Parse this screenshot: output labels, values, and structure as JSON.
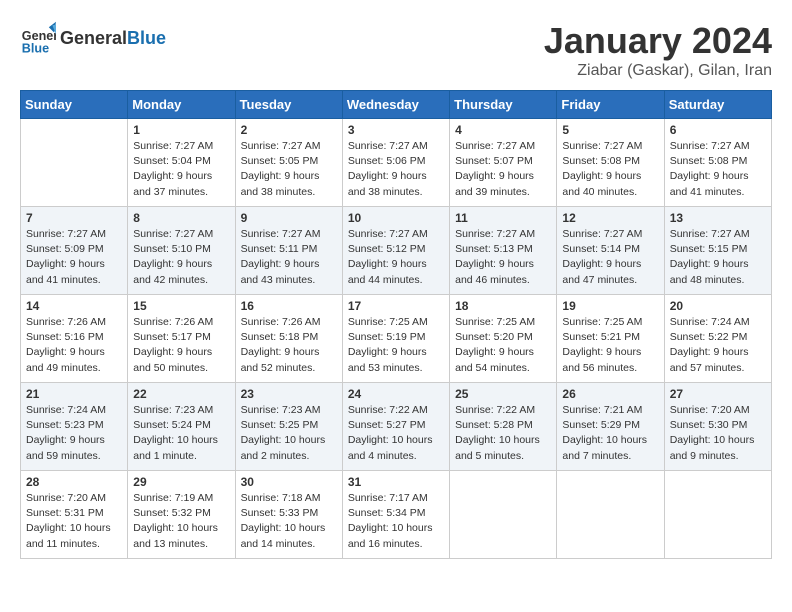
{
  "header": {
    "logo_general": "General",
    "logo_blue": "Blue",
    "month_title": "January 2024",
    "location": "Ziabar (Gaskar), Gilan, Iran"
  },
  "days_of_week": [
    "Sunday",
    "Monday",
    "Tuesday",
    "Wednesday",
    "Thursday",
    "Friday",
    "Saturday"
  ],
  "weeks": [
    [
      {
        "day": "",
        "info": ""
      },
      {
        "day": "1",
        "info": "Sunrise: 7:27 AM\nSunset: 5:04 PM\nDaylight: 9 hours\nand 37 minutes."
      },
      {
        "day": "2",
        "info": "Sunrise: 7:27 AM\nSunset: 5:05 PM\nDaylight: 9 hours\nand 38 minutes."
      },
      {
        "day": "3",
        "info": "Sunrise: 7:27 AM\nSunset: 5:06 PM\nDaylight: 9 hours\nand 38 minutes."
      },
      {
        "day": "4",
        "info": "Sunrise: 7:27 AM\nSunset: 5:07 PM\nDaylight: 9 hours\nand 39 minutes."
      },
      {
        "day": "5",
        "info": "Sunrise: 7:27 AM\nSunset: 5:08 PM\nDaylight: 9 hours\nand 40 minutes."
      },
      {
        "day": "6",
        "info": "Sunrise: 7:27 AM\nSunset: 5:08 PM\nDaylight: 9 hours\nand 41 minutes."
      }
    ],
    [
      {
        "day": "7",
        "info": "Sunrise: 7:27 AM\nSunset: 5:09 PM\nDaylight: 9 hours\nand 41 minutes."
      },
      {
        "day": "8",
        "info": "Sunrise: 7:27 AM\nSunset: 5:10 PM\nDaylight: 9 hours\nand 42 minutes."
      },
      {
        "day": "9",
        "info": "Sunrise: 7:27 AM\nSunset: 5:11 PM\nDaylight: 9 hours\nand 43 minutes."
      },
      {
        "day": "10",
        "info": "Sunrise: 7:27 AM\nSunset: 5:12 PM\nDaylight: 9 hours\nand 44 minutes."
      },
      {
        "day": "11",
        "info": "Sunrise: 7:27 AM\nSunset: 5:13 PM\nDaylight: 9 hours\nand 46 minutes."
      },
      {
        "day": "12",
        "info": "Sunrise: 7:27 AM\nSunset: 5:14 PM\nDaylight: 9 hours\nand 47 minutes."
      },
      {
        "day": "13",
        "info": "Sunrise: 7:27 AM\nSunset: 5:15 PM\nDaylight: 9 hours\nand 48 minutes."
      }
    ],
    [
      {
        "day": "14",
        "info": "Sunrise: 7:26 AM\nSunset: 5:16 PM\nDaylight: 9 hours\nand 49 minutes."
      },
      {
        "day": "15",
        "info": "Sunrise: 7:26 AM\nSunset: 5:17 PM\nDaylight: 9 hours\nand 50 minutes."
      },
      {
        "day": "16",
        "info": "Sunrise: 7:26 AM\nSunset: 5:18 PM\nDaylight: 9 hours\nand 52 minutes."
      },
      {
        "day": "17",
        "info": "Sunrise: 7:25 AM\nSunset: 5:19 PM\nDaylight: 9 hours\nand 53 minutes."
      },
      {
        "day": "18",
        "info": "Sunrise: 7:25 AM\nSunset: 5:20 PM\nDaylight: 9 hours\nand 54 minutes."
      },
      {
        "day": "19",
        "info": "Sunrise: 7:25 AM\nSunset: 5:21 PM\nDaylight: 9 hours\nand 56 minutes."
      },
      {
        "day": "20",
        "info": "Sunrise: 7:24 AM\nSunset: 5:22 PM\nDaylight: 9 hours\nand 57 minutes."
      }
    ],
    [
      {
        "day": "21",
        "info": "Sunrise: 7:24 AM\nSunset: 5:23 PM\nDaylight: 9 hours\nand 59 minutes."
      },
      {
        "day": "22",
        "info": "Sunrise: 7:23 AM\nSunset: 5:24 PM\nDaylight: 10 hours\nand 1 minute."
      },
      {
        "day": "23",
        "info": "Sunrise: 7:23 AM\nSunset: 5:25 PM\nDaylight: 10 hours\nand 2 minutes."
      },
      {
        "day": "24",
        "info": "Sunrise: 7:22 AM\nSunset: 5:27 PM\nDaylight: 10 hours\nand 4 minutes."
      },
      {
        "day": "25",
        "info": "Sunrise: 7:22 AM\nSunset: 5:28 PM\nDaylight: 10 hours\nand 5 minutes."
      },
      {
        "day": "26",
        "info": "Sunrise: 7:21 AM\nSunset: 5:29 PM\nDaylight: 10 hours\nand 7 minutes."
      },
      {
        "day": "27",
        "info": "Sunrise: 7:20 AM\nSunset: 5:30 PM\nDaylight: 10 hours\nand 9 minutes."
      }
    ],
    [
      {
        "day": "28",
        "info": "Sunrise: 7:20 AM\nSunset: 5:31 PM\nDaylight: 10 hours\nand 11 minutes."
      },
      {
        "day": "29",
        "info": "Sunrise: 7:19 AM\nSunset: 5:32 PM\nDaylight: 10 hours\nand 13 minutes."
      },
      {
        "day": "30",
        "info": "Sunrise: 7:18 AM\nSunset: 5:33 PM\nDaylight: 10 hours\nand 14 minutes."
      },
      {
        "day": "31",
        "info": "Sunrise: 7:17 AM\nSunset: 5:34 PM\nDaylight: 10 hours\nand 16 minutes."
      },
      {
        "day": "",
        "info": ""
      },
      {
        "day": "",
        "info": ""
      },
      {
        "day": "",
        "info": ""
      }
    ]
  ]
}
